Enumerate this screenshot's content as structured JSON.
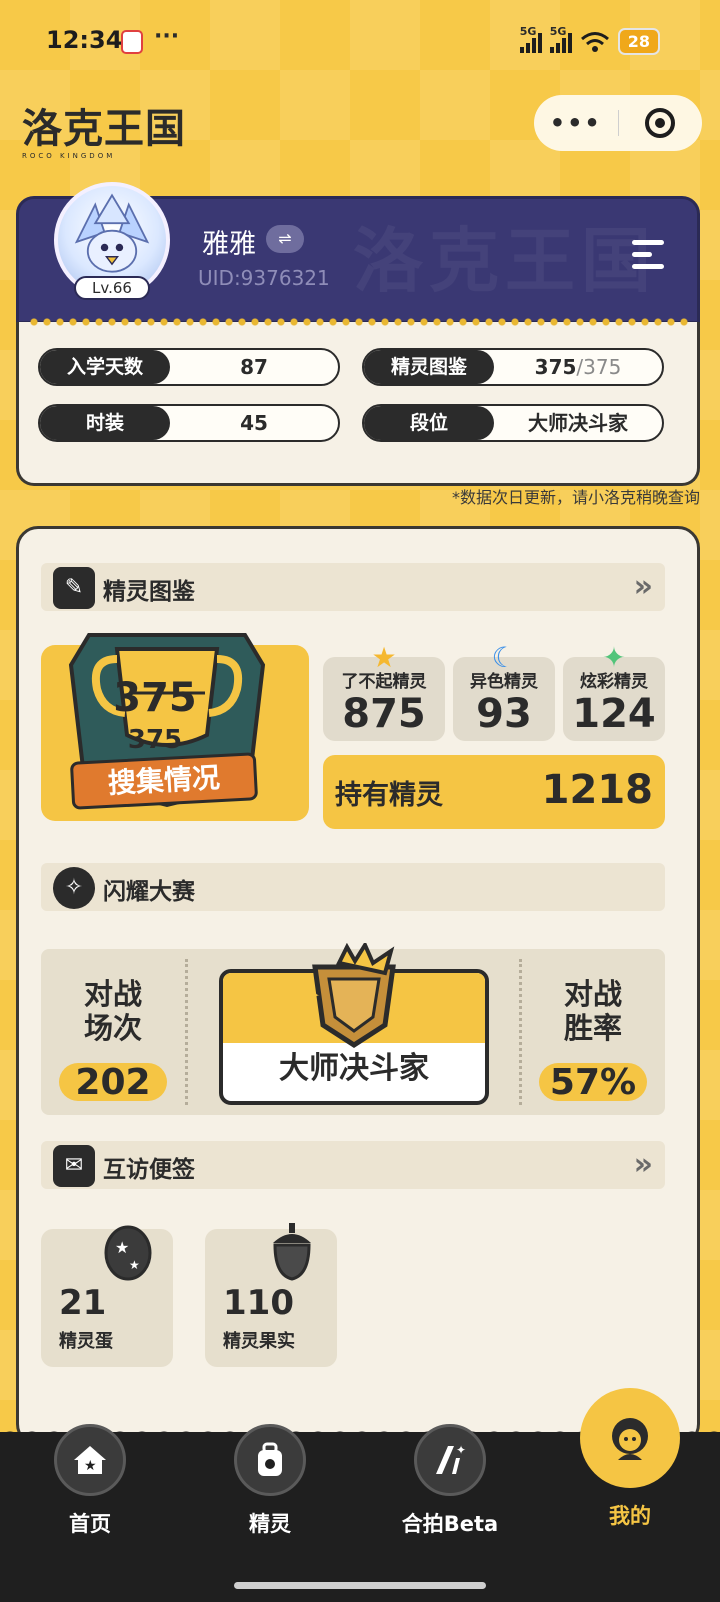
{
  "status_bar": {
    "time": "12:34",
    "dots": "···",
    "net1": "5G",
    "net2": "5G",
    "battery": "28"
  },
  "header": {
    "logo": "洛克王国",
    "logo_sub": "ROCO KINGDOM"
  },
  "capsule": {
    "more": "•••"
  },
  "profile": {
    "name": "雅雅",
    "switch_glyph": "⇌",
    "uid": "UID:9376321",
    "level": "Lv.66",
    "bg_pattern": "洛克王国"
  },
  "stats": [
    {
      "label": "入学天数",
      "value": "87"
    },
    {
      "label": "精灵图鉴",
      "value": "375",
      "total": "/375"
    },
    {
      "label": "时装",
      "value": "45"
    },
    {
      "label": "段位",
      "value": "大师决斗家"
    }
  ],
  "note": "*数据次日更新，请小洛克稍晚查询",
  "sections": {
    "pokedex": {
      "title": "精灵图鉴",
      "arrow": "»"
    },
    "battle": {
      "title": "闪耀大赛"
    },
    "visit": {
      "title": "互访便签",
      "arrow": "»"
    }
  },
  "collection": {
    "collected": "375",
    "total": "375",
    "banner": "搜集情况"
  },
  "mini_stats": [
    {
      "label": "了不起精灵",
      "value": "875"
    },
    {
      "label": "异色精灵",
      "value": "93"
    },
    {
      "label": "炫彩精灵",
      "value": "124"
    }
  ],
  "hold": {
    "label": "持有精灵",
    "value": "1218"
  },
  "battle": {
    "matches_label_1": "对战",
    "matches_label_2": "场次",
    "matches": "202",
    "rank": "大师决斗家",
    "winrate_label_1": "对战",
    "winrate_label_2": "胜率",
    "winrate": "57%"
  },
  "items": [
    {
      "value": "21",
      "label": "精灵蛋"
    },
    {
      "value": "110",
      "label": "精灵果实"
    }
  ],
  "nav": [
    {
      "label": "首页",
      "icon": "home-icon"
    },
    {
      "label": "精灵",
      "icon": "backpack-icon"
    },
    {
      "label": "合拍Beta",
      "icon": "ai-icon"
    },
    {
      "label": "我的",
      "icon": "profile-icon"
    }
  ],
  "colors": {
    "accent": "#f5c544",
    "profile_bg": "#3a3873",
    "card_bg": "#f6f1e6",
    "nav_bg": "#1f1f1f"
  }
}
